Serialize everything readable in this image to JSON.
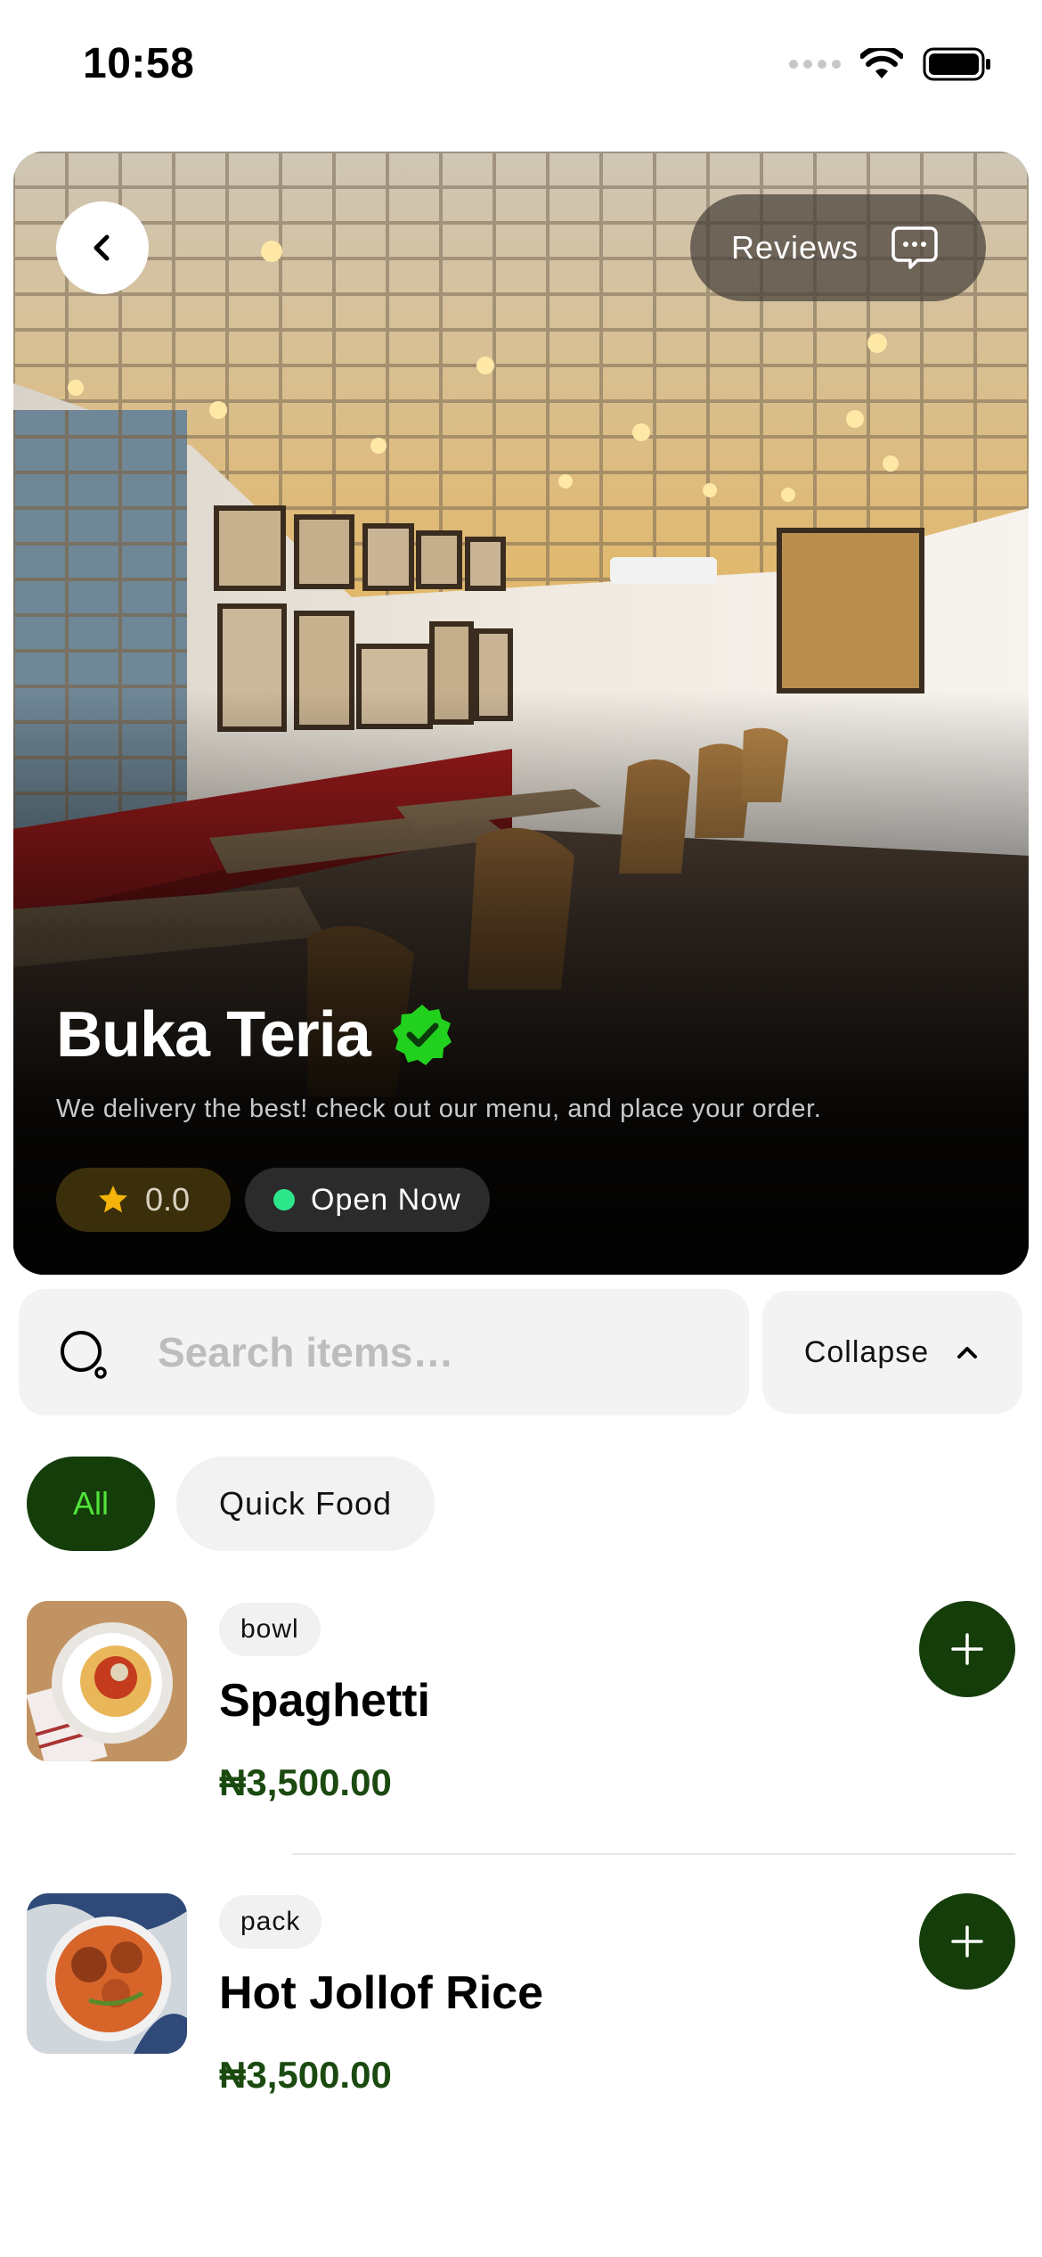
{
  "status_bar": {
    "time": "10:58",
    "icons": [
      "signal-icon",
      "wifi-icon",
      "battery-icon"
    ]
  },
  "header": {
    "back_icon": "chevron-left-icon",
    "reviews_label": "Reviews",
    "reviews_icon": "chat-bubble-icon"
  },
  "store": {
    "name": "Buka Teria",
    "verified_icon": "verified-badge-icon",
    "tagline": "We delivery the best! check out our menu, and place your order.",
    "rating": "0.0",
    "rating_icon": "star-icon",
    "status": "Open Now"
  },
  "search": {
    "placeholder": "Search items…",
    "value": ""
  },
  "collapse_label": "Collapse",
  "filters": [
    {
      "label": "All",
      "selected": true
    },
    {
      "label": "Quick Food",
      "selected": false
    }
  ],
  "items": [
    {
      "unit": "bowl",
      "name": "Spaghetti",
      "price": "₦3,500.00"
    },
    {
      "unit": "pack",
      "name": "Hot Jollof Rice",
      "price": "₦3,500.00"
    }
  ],
  "colors": {
    "brand_green": "#143d0a",
    "brand_green_text": "#52e33a",
    "price_green": "#1b4a10",
    "verified_green": "#22d11e",
    "star_yellow": "#f5b40c",
    "open_dot": "#2ee68a"
  }
}
